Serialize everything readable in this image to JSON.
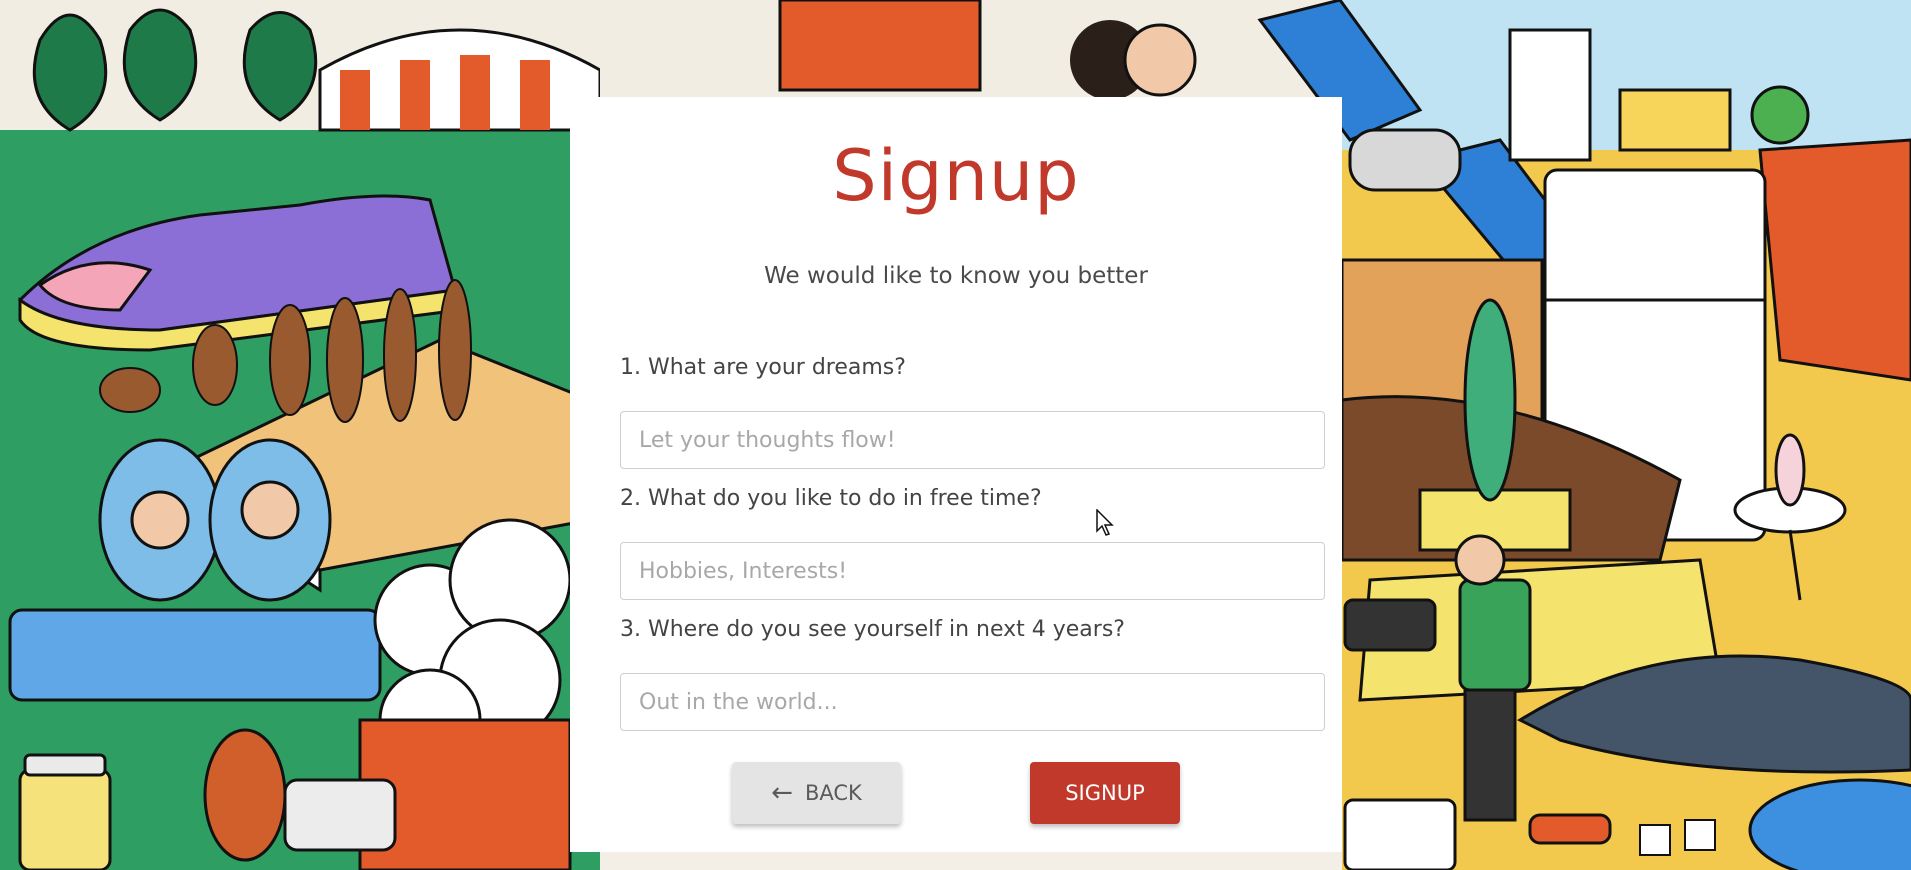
{
  "form": {
    "title": "Signup",
    "subtitle": "We would like to know you better",
    "questions": [
      {
        "label": "1. What are your dreams?",
        "placeholder": "Let your thoughts flow!",
        "value": ""
      },
      {
        "label": "2. What do you like to do in free time?",
        "placeholder": "Hobbies, Interests!",
        "value": ""
      },
      {
        "label": "3. Where do you see yourself in next 4 years?",
        "placeholder": "Out in the world...",
        "value": ""
      }
    ],
    "back_label": "BACK",
    "signup_label": "SIGNUP"
  },
  "colors": {
    "accent": "#c0392b",
    "back_button": "#e4e4e4",
    "card": "#ffffff"
  },
  "icons": {
    "back": "arrow-left-icon",
    "cursor": "mouse-pointer-icon"
  }
}
